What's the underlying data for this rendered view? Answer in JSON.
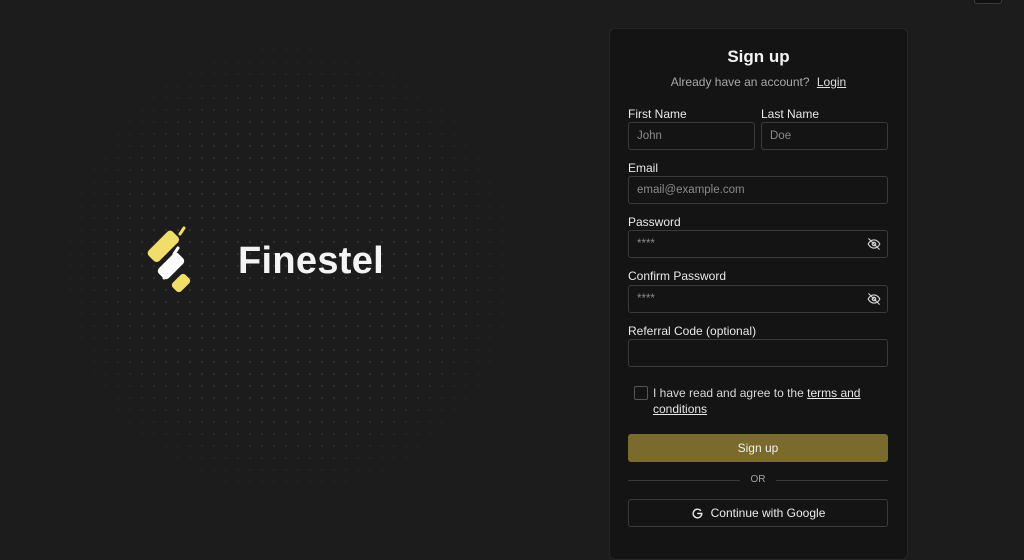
{
  "brand": {
    "name": "Finestel"
  },
  "form": {
    "title": "Sign up",
    "login_prompt": "Already have an account?",
    "login_link": "Login",
    "first_name": {
      "label": "First Name",
      "placeholder": "John"
    },
    "last_name": {
      "label": "Last Name",
      "placeholder": "Doe"
    },
    "email": {
      "label": "Email",
      "placeholder": "email@example.com"
    },
    "password": {
      "label": "Password",
      "placeholder": "****"
    },
    "confirm_password": {
      "label": "Confirm Password",
      "placeholder": "****"
    },
    "referral": {
      "label": "Referral Code (optional)",
      "placeholder": ""
    },
    "agree_text": "I have read and agree to the",
    "terms_link": "terms and conditions",
    "submit_label": "Sign up",
    "divider_text": "OR",
    "google_label": "Continue with Google"
  },
  "colors": {
    "background": "#1c1c1c",
    "card": "#141414",
    "accent": "#7a6a2c",
    "logo_yellow": "#f0dd6a"
  },
  "icons": {
    "password_toggle": "eye-off-icon",
    "google": "google-icon",
    "logo": "finestel-logo"
  }
}
